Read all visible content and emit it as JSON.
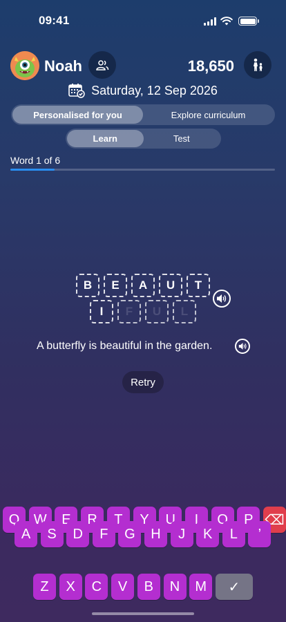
{
  "status_bar": {
    "time": "09:41"
  },
  "header": {
    "user_name": "Noah",
    "points": "18,650",
    "date": "Saturday, 12 Sep 2026"
  },
  "mode_tabs": {
    "personalised": "Personalised for you",
    "explore": "Explore curriculum",
    "active": "personalised"
  },
  "learn_tabs": {
    "learn": "Learn",
    "test": "Test",
    "active": "learn"
  },
  "progress": {
    "label": "Word 1 of 6",
    "current": 1,
    "total": 6
  },
  "word": {
    "letters": [
      {
        "char": "B",
        "revealed": true
      },
      {
        "char": "E",
        "revealed": true
      },
      {
        "char": "A",
        "revealed": true
      },
      {
        "char": "U",
        "revealed": true
      },
      {
        "char": "T",
        "revealed": true
      },
      {
        "char": "I",
        "revealed": true
      },
      {
        "char": "F",
        "revealed": false
      },
      {
        "char": "U",
        "revealed": false
      },
      {
        "char": "L",
        "revealed": false
      }
    ]
  },
  "sentence": "A butterfly is beautiful in the garden.",
  "retry_label": "Retry",
  "keyboard": {
    "rows": [
      [
        "Q",
        "W",
        "E",
        "R",
        "T",
        "Y",
        "U",
        "I",
        "O",
        "P",
        "⌫"
      ],
      [
        "A",
        "S",
        "D",
        "F",
        "G",
        "H",
        "J",
        "K",
        "L",
        "’"
      ],
      [
        "Z",
        "X",
        "C",
        "V",
        "B",
        "N",
        "M",
        "✓"
      ]
    ]
  },
  "colors": {
    "key": "#b42ed0",
    "backspace": "#e03e4c",
    "done": "#757486",
    "progress": "#2a8ef0",
    "avatar": "#f08a52"
  },
  "icons": [
    "signal-icon",
    "wifi-icon",
    "battery-icon",
    "friends-icon",
    "walking-icon",
    "calendar-icon",
    "speaker-icon",
    "backspace-icon",
    "checkmark-icon"
  ]
}
